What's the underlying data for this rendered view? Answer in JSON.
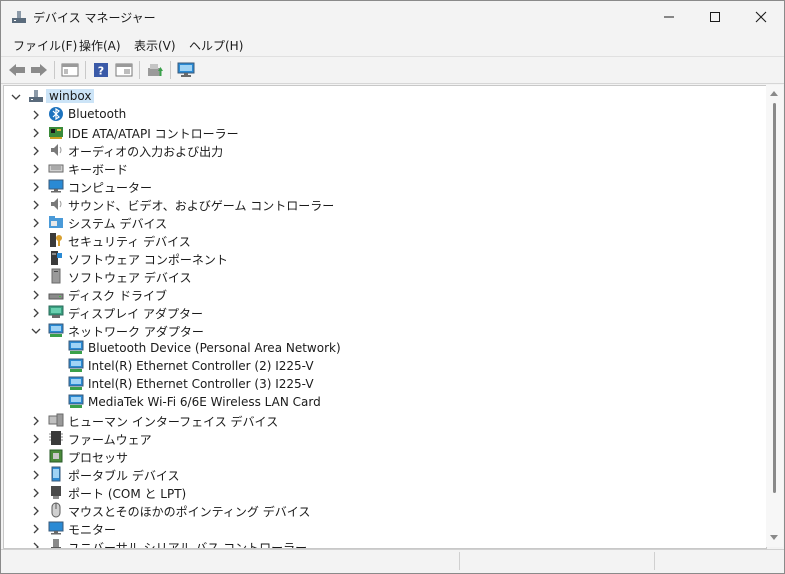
{
  "window": {
    "title": "デバイス マネージャー",
    "controls": {
      "minimize": "—",
      "maximize": "☐",
      "close": "✕"
    }
  },
  "menu": [
    "ファイル(F)",
    "操作(A)",
    "表示(V)",
    "ヘルプ(H)"
  ],
  "toolbar": [
    "back-icon",
    "forward-icon",
    "properties-pane-icon",
    "help-icon",
    "view-icon",
    "update-driver-icon",
    "scan-hardware-icon"
  ],
  "tree": {
    "root": "winbox",
    "categories": [
      {
        "label": "Bluetooth",
        "icon": "bluetooth-icon",
        "expanded": false
      },
      {
        "label": "IDE ATA/ATAPI コントローラー",
        "icon": "ide-controller-icon",
        "expanded": false
      },
      {
        "label": "オーディオの入力および出力",
        "icon": "speaker-icon",
        "expanded": false
      },
      {
        "label": "キーボード",
        "icon": "keyboard-icon",
        "expanded": false
      },
      {
        "label": "コンピューター",
        "icon": "monitor-icon",
        "expanded": false
      },
      {
        "label": "サウンド、ビデオ、およびゲーム コントローラー",
        "icon": "speaker-icon",
        "expanded": false
      },
      {
        "label": "システム デバイス",
        "icon": "system-folder-icon",
        "expanded": false
      },
      {
        "label": "セキュリティ デバイス",
        "icon": "security-key-icon",
        "expanded": false
      },
      {
        "label": "ソフトウェア コンポーネント",
        "icon": "software-component-icon",
        "expanded": false
      },
      {
        "label": "ソフトウェア デバイス",
        "icon": "software-device-icon",
        "expanded": false
      },
      {
        "label": "ディスク ドライブ",
        "icon": "disk-drive-icon",
        "expanded": false
      },
      {
        "label": "ディスプレイ アダプター",
        "icon": "display-adapter-icon",
        "expanded": false
      },
      {
        "label": "ネットワーク アダプター",
        "icon": "network-adapter-icon",
        "expanded": true,
        "children": [
          "Bluetooth Device (Personal Area Network)",
          "Intel(R) Ethernet Controller (2) I225-V",
          "Intel(R) Ethernet Controller (3) I225-V",
          "MediaTek Wi-Fi 6/6E Wireless LAN Card"
        ]
      },
      {
        "label": "ヒューマン インターフェイス デバイス",
        "icon": "hid-icon",
        "expanded": false
      },
      {
        "label": "ファームウェア",
        "icon": "firmware-icon",
        "expanded": false
      },
      {
        "label": "プロセッサ",
        "icon": "processor-icon",
        "expanded": false
      },
      {
        "label": "ポータブル デバイス",
        "icon": "portable-device-icon",
        "expanded": false
      },
      {
        "label": "ポート (COM と LPT)",
        "icon": "port-icon",
        "expanded": false
      },
      {
        "label": "マウスとそのほかのポインティング デバイス",
        "icon": "mouse-icon",
        "expanded": false
      },
      {
        "label": "モニター",
        "icon": "monitor-icon",
        "expanded": false
      },
      {
        "label": "ユニバーサル シリアル バス コントローラー",
        "icon": "usb-icon",
        "expanded": false
      }
    ]
  },
  "colors": {
    "selection": "#cce4f7",
    "accent": "#1e73be",
    "monitor_blue": "#2a8ad4"
  }
}
